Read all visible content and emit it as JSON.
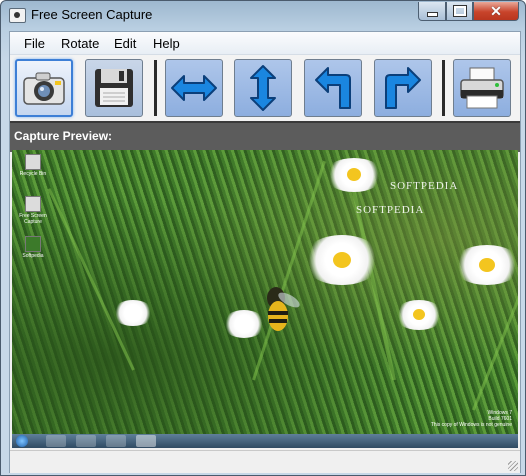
{
  "window": {
    "title": "Free Screen Capture"
  },
  "menu": [
    {
      "label": "File"
    },
    {
      "label": "Rotate"
    },
    {
      "label": "Edit"
    },
    {
      "label": "Help"
    }
  ],
  "toolbar": {
    "buttons": [
      {
        "icon": "camera-icon",
        "active": true
      },
      {
        "icon": "floppy-disk-icon",
        "active": false
      },
      {
        "icon": "horizontal-arrows-icon",
        "active": false
      },
      {
        "icon": "vertical-arrows-icon",
        "active": false
      },
      {
        "icon": "rotate-left-icon",
        "active": false
      },
      {
        "icon": "rotate-right-icon",
        "active": false
      },
      {
        "icon": "printer-icon",
        "active": false
      }
    ]
  },
  "preview": {
    "caption": "Capture Preview:",
    "desktop_icons": [
      {
        "label": "Recycle Bin"
      },
      {
        "label": "Free Screen Capture"
      },
      {
        "label": "Softpedia"
      }
    ],
    "watermarks": [
      "SOFTPEDIA",
      "SOFTPEDIA"
    ],
    "windows_note": [
      "Windows 7",
      "Build 7601",
      "This copy of Windows is not genuine"
    ]
  },
  "status": {
    "text": ""
  },
  "colors": {
    "toolbar_button": "#9cbbe6",
    "caption_bar": "#5c5c5c",
    "arrow_blue": "#1a86e0"
  }
}
